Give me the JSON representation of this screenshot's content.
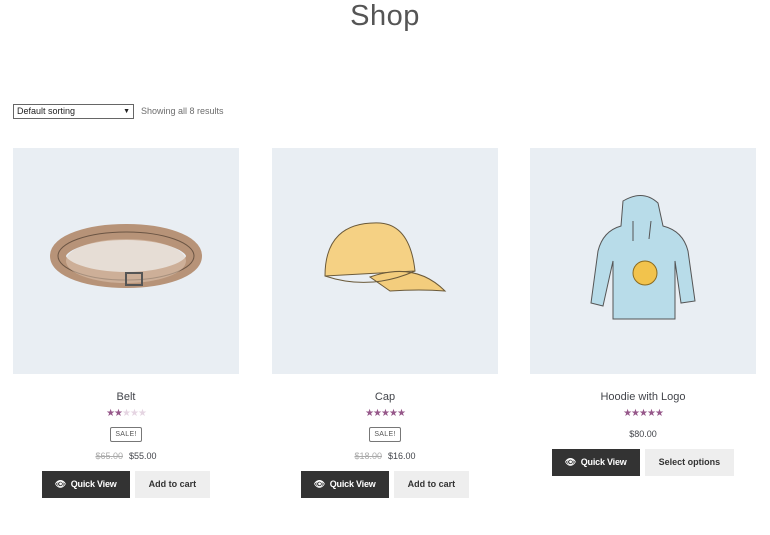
{
  "page": {
    "title": "Shop"
  },
  "toolbar": {
    "sorting": "Default sorting",
    "result_count": "Showing all 8 results"
  },
  "colors": {
    "star": "#96588a",
    "image_bg": "#e9eef3",
    "quick_view_bg": "#333333"
  },
  "products": [
    {
      "name": "Belt",
      "rating": 2,
      "max_rating": 5,
      "badge": "SALE!",
      "old_price": "$65.00",
      "price": "$55.00",
      "quick_view": "Quick View",
      "action": "Add to cart",
      "icon": "eye-icon"
    },
    {
      "name": "Cap",
      "rating": 5,
      "max_rating": 5,
      "badge": "SALE!",
      "old_price": "$18.00",
      "price": "$16.00",
      "quick_view": "Quick View",
      "action": "Add to cart",
      "icon": "eye-icon"
    },
    {
      "name": "Hoodie with Logo",
      "rating": 5,
      "max_rating": 5,
      "price": "$80.00",
      "quick_view": "Quick View",
      "action": "Select options",
      "icon": "eye-icon"
    }
  ]
}
